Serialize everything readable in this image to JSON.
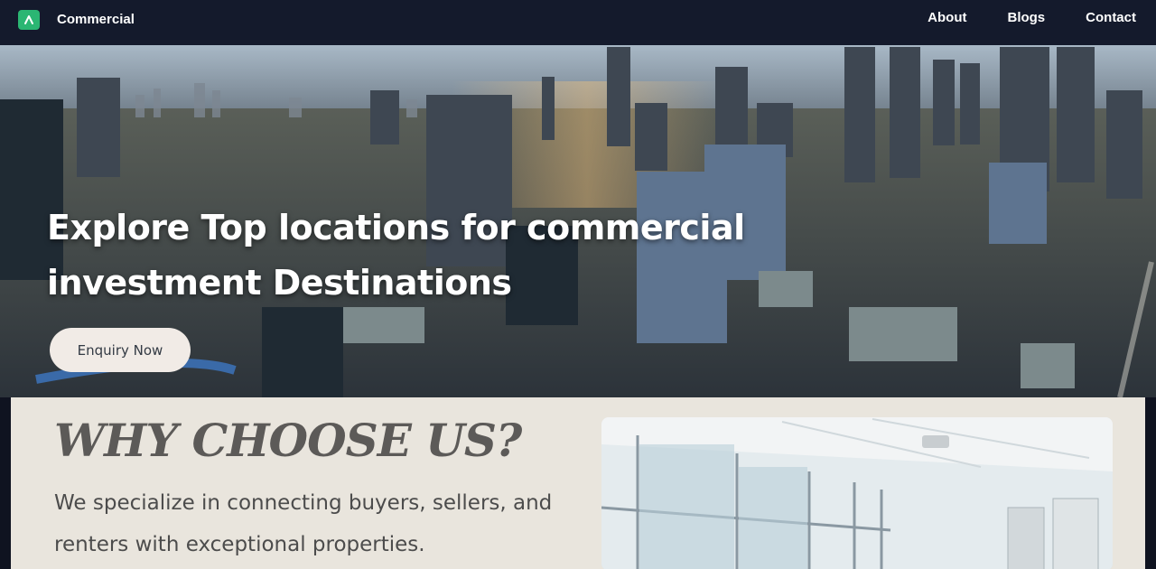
{
  "nav": {
    "brand": "Commercial",
    "links": [
      "About",
      "Blogs",
      "Contact"
    ]
  },
  "hero": {
    "title": "Explore Top locations for commercial investment Destinations",
    "cta_label": "Enquiry Now"
  },
  "why": {
    "title": "WHY CHOOSE US?",
    "text": "We specialize in connecting buyers, sellers, and renters with exceptional properties."
  },
  "colors": {
    "nav_bg": "#141a2c",
    "logo_accent": "#2bb673",
    "section_bg": "#e9e5dd"
  },
  "icons": {
    "logo": "caret-up-logo-icon"
  }
}
